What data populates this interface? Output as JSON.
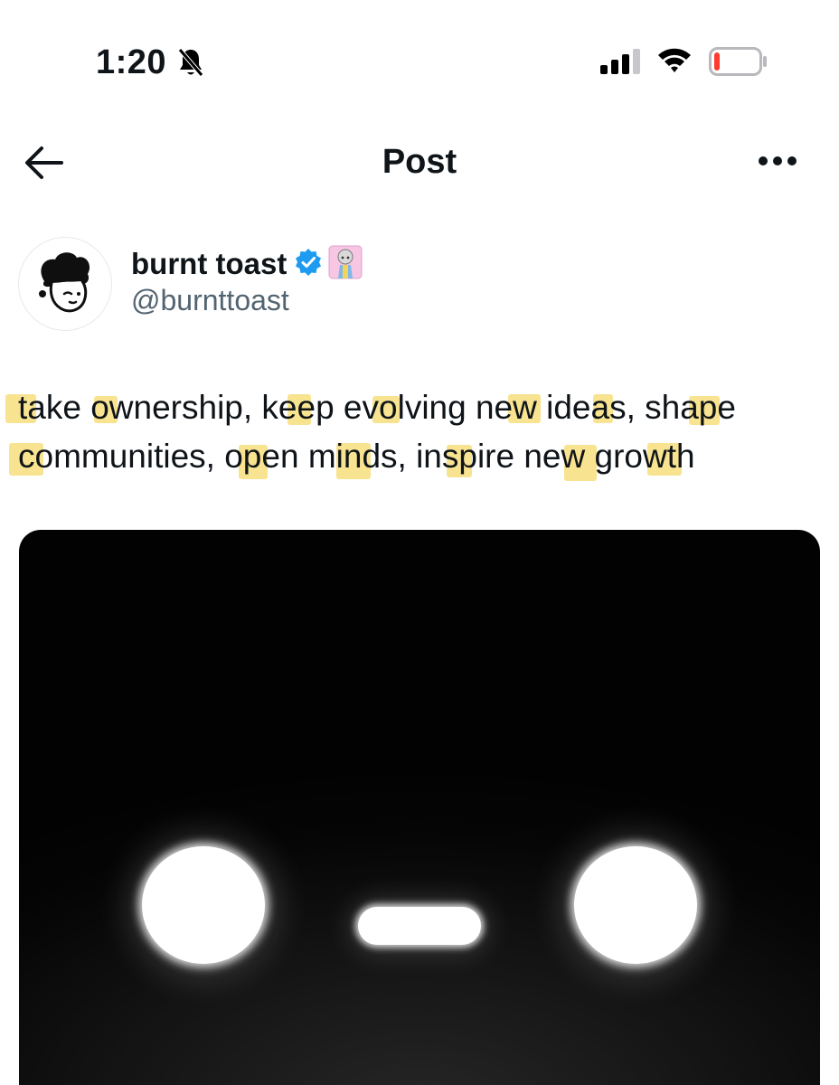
{
  "status_bar": {
    "time": "1:20",
    "silent_icon": "bell-slash-icon",
    "signal_icon": "cellular-signal-icon",
    "wifi_icon": "wifi-icon",
    "battery_icon": "battery-low-icon",
    "battery_level": 0.12,
    "battery_color": "#ff3b30"
  },
  "header": {
    "back_icon": "arrow-left-icon",
    "title": "Post",
    "more_icon": "more-horizontal-icon"
  },
  "post": {
    "author": {
      "name": "burnt toast",
      "handle": "@burnttoast",
      "verified_icon": "verified-check-icon",
      "verified_color": "#1d9bf0",
      "badge_icon": "affiliate-badge-icon",
      "avatar_icon": "cartoon-face-avatar-icon"
    },
    "text_lines": [
      "take ownership, keep evolving new ideas, shape",
      "communities, open minds, inspire new growth"
    ],
    "highlight_color": "#f5d96b",
    "media": {
      "image_icon": "glowing-robot-face-image"
    }
  }
}
